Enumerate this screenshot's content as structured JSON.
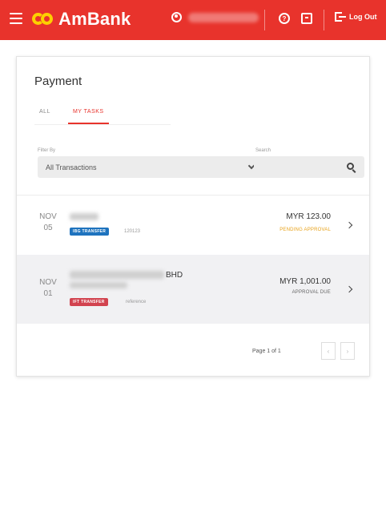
{
  "header": {
    "brand": "AmBank",
    "logout_label": "Log Out",
    "help_glyph": "?",
    "icons": [
      "menu-icon",
      "user-icon",
      "help-icon",
      "message-icon",
      "logout-icon"
    ],
    "bg_color": "#e8332c",
    "logo_color": "#fdd000"
  },
  "page": {
    "title": "Payment",
    "tabs": [
      {
        "label": "ALL",
        "active": false
      },
      {
        "label": "MY TASKS",
        "active": true
      }
    ]
  },
  "filter": {
    "label": "Filter By",
    "value": "All Transactions"
  },
  "search": {
    "label": "Search",
    "placeholder": ""
  },
  "transactions": [
    {
      "month": "NOV",
      "day": "05",
      "type": "IBG TRANSFER",
      "reference": "120123",
      "amount": "MYR 123.00",
      "status": "PENDING APPROVAL",
      "status_color": "#e8a21a"
    },
    {
      "month": "NOV",
      "day": "01",
      "name_suffix": "BHD",
      "type": "IFT TRANSFER",
      "reference": "reference",
      "amount": "MYR 1,001.00",
      "status": "APPROVAL DUE",
      "status_color": "#666666"
    }
  ],
  "pagination": {
    "label": "Page 1 of 1",
    "prev": "‹",
    "next": "›"
  }
}
